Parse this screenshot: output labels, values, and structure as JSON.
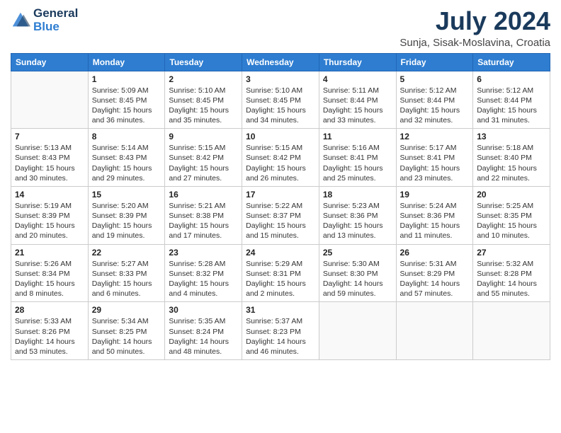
{
  "logo": {
    "line1": "General",
    "line2": "Blue"
  },
  "title": "July 2024",
  "subtitle": "Sunja, Sisak-Moslavina, Croatia",
  "days_header": [
    "Sunday",
    "Monday",
    "Tuesday",
    "Wednesday",
    "Thursday",
    "Friday",
    "Saturday"
  ],
  "weeks": [
    [
      {
        "day": "",
        "info": ""
      },
      {
        "day": "1",
        "info": "Sunrise: 5:09 AM\nSunset: 8:45 PM\nDaylight: 15 hours\nand 36 minutes."
      },
      {
        "day": "2",
        "info": "Sunrise: 5:10 AM\nSunset: 8:45 PM\nDaylight: 15 hours\nand 35 minutes."
      },
      {
        "day": "3",
        "info": "Sunrise: 5:10 AM\nSunset: 8:45 PM\nDaylight: 15 hours\nand 34 minutes."
      },
      {
        "day": "4",
        "info": "Sunrise: 5:11 AM\nSunset: 8:44 PM\nDaylight: 15 hours\nand 33 minutes."
      },
      {
        "day": "5",
        "info": "Sunrise: 5:12 AM\nSunset: 8:44 PM\nDaylight: 15 hours\nand 32 minutes."
      },
      {
        "day": "6",
        "info": "Sunrise: 5:12 AM\nSunset: 8:44 PM\nDaylight: 15 hours\nand 31 minutes."
      }
    ],
    [
      {
        "day": "7",
        "info": "Sunrise: 5:13 AM\nSunset: 8:43 PM\nDaylight: 15 hours\nand 30 minutes."
      },
      {
        "day": "8",
        "info": "Sunrise: 5:14 AM\nSunset: 8:43 PM\nDaylight: 15 hours\nand 29 minutes."
      },
      {
        "day": "9",
        "info": "Sunrise: 5:15 AM\nSunset: 8:42 PM\nDaylight: 15 hours\nand 27 minutes."
      },
      {
        "day": "10",
        "info": "Sunrise: 5:15 AM\nSunset: 8:42 PM\nDaylight: 15 hours\nand 26 minutes."
      },
      {
        "day": "11",
        "info": "Sunrise: 5:16 AM\nSunset: 8:41 PM\nDaylight: 15 hours\nand 25 minutes."
      },
      {
        "day": "12",
        "info": "Sunrise: 5:17 AM\nSunset: 8:41 PM\nDaylight: 15 hours\nand 23 minutes."
      },
      {
        "day": "13",
        "info": "Sunrise: 5:18 AM\nSunset: 8:40 PM\nDaylight: 15 hours\nand 22 minutes."
      }
    ],
    [
      {
        "day": "14",
        "info": "Sunrise: 5:19 AM\nSunset: 8:39 PM\nDaylight: 15 hours\nand 20 minutes."
      },
      {
        "day": "15",
        "info": "Sunrise: 5:20 AM\nSunset: 8:39 PM\nDaylight: 15 hours\nand 19 minutes."
      },
      {
        "day": "16",
        "info": "Sunrise: 5:21 AM\nSunset: 8:38 PM\nDaylight: 15 hours\nand 17 minutes."
      },
      {
        "day": "17",
        "info": "Sunrise: 5:22 AM\nSunset: 8:37 PM\nDaylight: 15 hours\nand 15 minutes."
      },
      {
        "day": "18",
        "info": "Sunrise: 5:23 AM\nSunset: 8:36 PM\nDaylight: 15 hours\nand 13 minutes."
      },
      {
        "day": "19",
        "info": "Sunrise: 5:24 AM\nSunset: 8:36 PM\nDaylight: 15 hours\nand 11 minutes."
      },
      {
        "day": "20",
        "info": "Sunrise: 5:25 AM\nSunset: 8:35 PM\nDaylight: 15 hours\nand 10 minutes."
      }
    ],
    [
      {
        "day": "21",
        "info": "Sunrise: 5:26 AM\nSunset: 8:34 PM\nDaylight: 15 hours\nand 8 minutes."
      },
      {
        "day": "22",
        "info": "Sunrise: 5:27 AM\nSunset: 8:33 PM\nDaylight: 15 hours\nand 6 minutes."
      },
      {
        "day": "23",
        "info": "Sunrise: 5:28 AM\nSunset: 8:32 PM\nDaylight: 15 hours\nand 4 minutes."
      },
      {
        "day": "24",
        "info": "Sunrise: 5:29 AM\nSunset: 8:31 PM\nDaylight: 15 hours\nand 2 minutes."
      },
      {
        "day": "25",
        "info": "Sunrise: 5:30 AM\nSunset: 8:30 PM\nDaylight: 14 hours\nand 59 minutes."
      },
      {
        "day": "26",
        "info": "Sunrise: 5:31 AM\nSunset: 8:29 PM\nDaylight: 14 hours\nand 57 minutes."
      },
      {
        "day": "27",
        "info": "Sunrise: 5:32 AM\nSunset: 8:28 PM\nDaylight: 14 hours\nand 55 minutes."
      }
    ],
    [
      {
        "day": "28",
        "info": "Sunrise: 5:33 AM\nSunset: 8:26 PM\nDaylight: 14 hours\nand 53 minutes."
      },
      {
        "day": "29",
        "info": "Sunrise: 5:34 AM\nSunset: 8:25 PM\nDaylight: 14 hours\nand 50 minutes."
      },
      {
        "day": "30",
        "info": "Sunrise: 5:35 AM\nSunset: 8:24 PM\nDaylight: 14 hours\nand 48 minutes."
      },
      {
        "day": "31",
        "info": "Sunrise: 5:37 AM\nSunset: 8:23 PM\nDaylight: 14 hours\nand 46 minutes."
      },
      {
        "day": "",
        "info": ""
      },
      {
        "day": "",
        "info": ""
      },
      {
        "day": "",
        "info": ""
      }
    ]
  ]
}
